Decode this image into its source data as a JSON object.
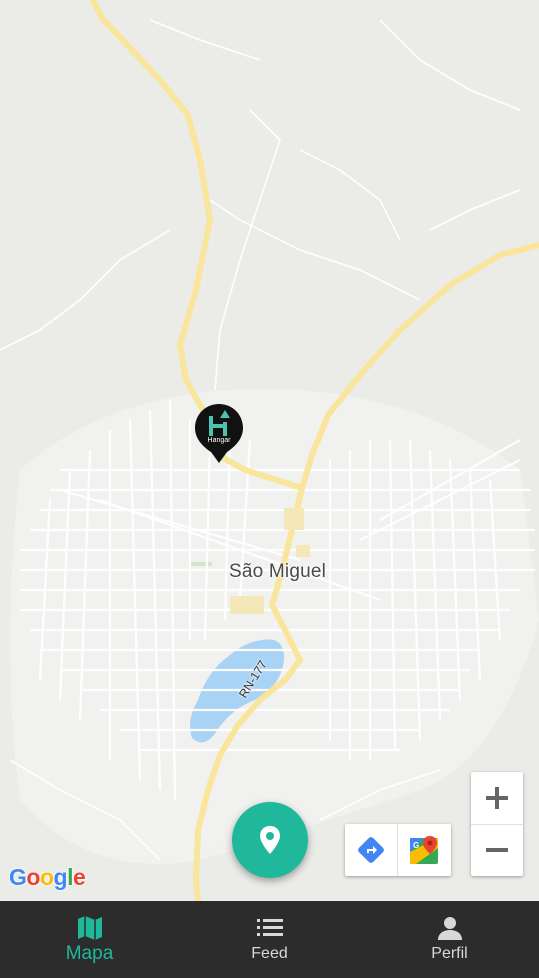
{
  "map": {
    "city_label": "São Miguel",
    "road_label": "RN-177",
    "marker": {
      "brand": "Hangar",
      "icon": "hangar-logo-pin-icon"
    },
    "attribution": "Google"
  },
  "map_controls": {
    "zoom_in": "+",
    "zoom_out": "−",
    "directions_icon": "directions-icon",
    "open_maps_icon": "google-maps-icon"
  },
  "fab": {
    "icon": "location-pin-icon",
    "color": "#20b89a"
  },
  "bottom_nav": {
    "items": [
      {
        "label": "Mapa",
        "icon": "map-icon",
        "active": true
      },
      {
        "label": "Feed",
        "icon": "list-icon",
        "active": false
      },
      {
        "label": "Perfil",
        "icon": "person-icon",
        "active": false
      }
    ],
    "active_color": "#20b89a",
    "background": "#2c2c2c"
  }
}
